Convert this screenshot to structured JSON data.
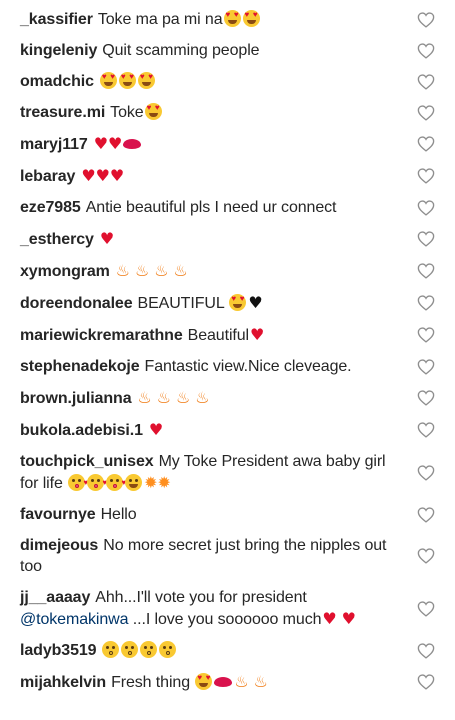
{
  "comments": [
    {
      "username": "_kassifier",
      "text": "Toke ma pa mi na",
      "emoji": [
        "heart-eyes",
        "heart-eyes"
      ]
    },
    {
      "username": "kingeleniy",
      "text": "Quit scamming people",
      "emoji": []
    },
    {
      "username": "omadchic",
      "text": "",
      "emoji": [
        "heart-eyes",
        "heart-eyes",
        "heart-eyes"
      ]
    },
    {
      "username": "treasure.mi",
      "text": "Toke",
      "emoji": [
        "heart-eyes"
      ]
    },
    {
      "username": "maryj117",
      "text": "",
      "emoji": [
        "two-hearts",
        "kiss-mark"
      ]
    },
    {
      "username": "lebaray",
      "text": "",
      "emoji": [
        "red-heart",
        "red-heart",
        "red-heart"
      ]
    },
    {
      "username": "eze7985",
      "text": "Antie beautiful pls I need ur connect",
      "emoji": []
    },
    {
      "username": "_esthercy",
      "text": "",
      "emoji": [
        "red-heart"
      ]
    },
    {
      "username": "xymongram",
      "text": "",
      "emoji": [
        "fire",
        "fire",
        "fire",
        "fire"
      ]
    },
    {
      "username": "doreendonalee",
      "text": "BEAUTIFUL",
      "emoji": [
        "heart-eyes",
        "black-heart"
      ]
    },
    {
      "username": "mariewickremarathne",
      "text": "Beautiful",
      "emoji": [
        "red-heart"
      ]
    },
    {
      "username": "stephenadekoje",
      "text": "Fantastic view.Nice cleveage.",
      "emoji": []
    },
    {
      "username": "brown.julianna",
      "text": "",
      "emoji": [
        "fire",
        "fire",
        "fire",
        "fire"
      ]
    },
    {
      "username": "bukola.adebisi.1",
      "text": "",
      "emoji": [
        "red-heart"
      ]
    },
    {
      "username": "touchpick_unisex",
      "text": "My Toke President awa baby girl for life",
      "emoji": [
        "kissing-heart",
        "kissing-heart",
        "kissing-heart",
        "grinning",
        "collision",
        "collision"
      ]
    },
    {
      "username": "favournye",
      "text": "Hello",
      "emoji": []
    },
    {
      "username": "dimejeous",
      "text": "No more secret just bring the nipples out too",
      "emoji": []
    },
    {
      "username": "jj__aaaay",
      "text": "Ahh...I'll vote you for president",
      "mention": "@tokemakinwa",
      "text_after": "...I love you soooooo much",
      "emoji": [
        "red-heart",
        "red-heart"
      ]
    },
    {
      "username": "ladyb3519",
      "text": "",
      "emoji": [
        "kissing-closed-eyes",
        "kissing-closed-eyes",
        "kissing-closed-eyes",
        "kissing-closed-eyes"
      ]
    },
    {
      "username": "mijahkelvin",
      "text": "Fresh thing",
      "emoji": [
        "heart-eyes",
        "kiss-mark",
        "fire",
        "fire"
      ]
    }
  ],
  "colors": {
    "text": "#262626",
    "mention": "#003569",
    "heart_outline": "#8e8e8e"
  },
  "icons": {
    "like": "heart-outline-icon"
  }
}
